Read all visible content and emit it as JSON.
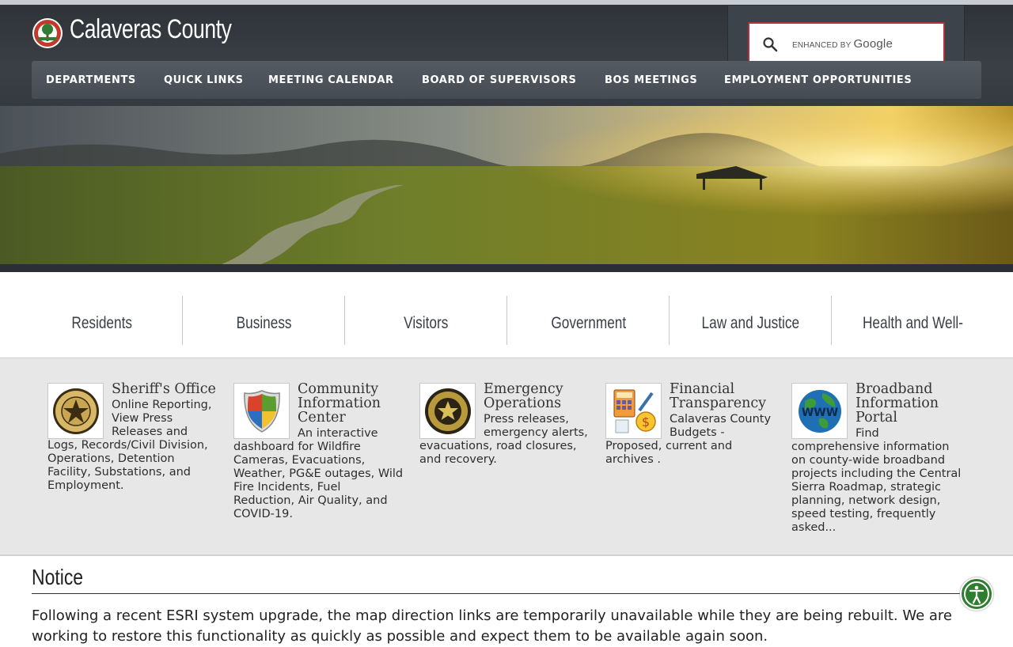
{
  "header": {
    "site_title": "Calaveras County",
    "search": {
      "label": "ENHANCED BY",
      "brand": "Google"
    }
  },
  "nav": {
    "items": [
      "DEPARTMENTS",
      "QUICK LINKS",
      "MEETING CALENDAR",
      "BOARD OF SUPERVISORS",
      "BOS MEETINGS",
      "EMPLOYMENT OPPORTUNITIES"
    ]
  },
  "audience": {
    "items": [
      "Residents",
      "Business",
      "Visitors",
      "Government",
      "Law and Justice",
      "Health and Well-Being"
    ]
  },
  "features": [
    {
      "title": "Sheriff's Office",
      "text": "Online Reporting, View Press Releases and Logs, Records/Civil Division, Operations, Detention Facility, Substations, and Employment.",
      "icon": "sheriff-badge-icon"
    },
    {
      "title": "Community Information Center",
      "text": "An interactive dashboard for Wildfire Cameras, Evacuations, Weather, PG&E outages, Wild Fire Incidents, Fuel Reduction, Air Quality, and COVID-19.",
      "icon": "shield-icon"
    },
    {
      "title": "Emergency Operations",
      "text": "Press releases, emergency alerts, evacuations, road closures, and recovery.",
      "icon": "emergency-badge-icon"
    },
    {
      "title": "Financial Transparency",
      "text": "Calaveras County Budgets - Proposed, current and archives .",
      "icon": "calculator-icon"
    },
    {
      "title": "Broadband Information Portal",
      "text": "Find comprehensive information on county-wide broadband projects including the Central Sierra Roadmap, strategic planning, network design, speed testing, frequently asked...",
      "icon": "www-globe-icon"
    }
  ],
  "notice": {
    "title": "Notice",
    "text": "Following a recent ESRI system upgrade, the map direction links are temporarily unavailable while they are being rebuilt. We are working to restore this functionality as quickly as possible and expect them to be available again soon."
  },
  "colors": {
    "header_bg": "#353a41",
    "nav_bg": "#4c525a",
    "band_bg": "#e7e7e7",
    "search_border": "#b3313a",
    "accessibility": "#2f7d2f"
  }
}
